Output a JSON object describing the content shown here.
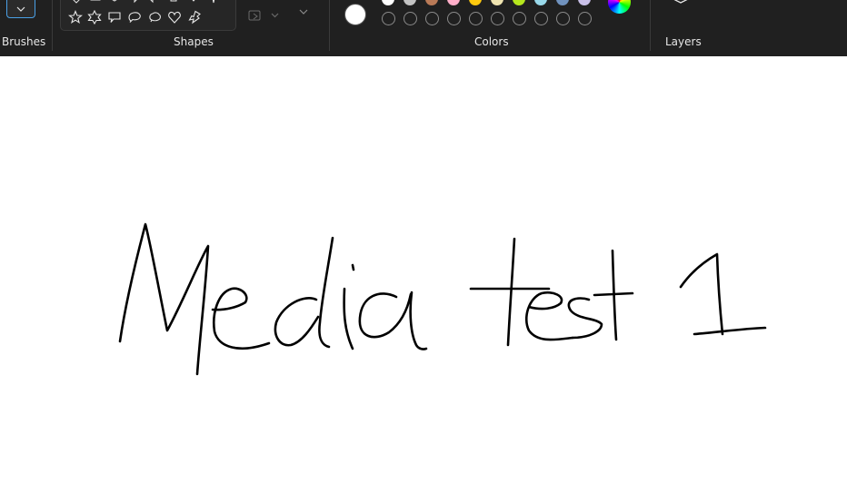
{
  "toolbar": {
    "groups": {
      "brushes": "Brushes",
      "shapes": "Shapes",
      "colors": "Colors",
      "layers": "Layers"
    },
    "primary_color": "#ffffff",
    "palette_row1": [
      "#ffffff",
      "#c3c3c3",
      "#b97a57",
      "#ffaec9",
      "#ffc90e",
      "#efe4b0",
      "#b5e61d",
      "#99d9ea",
      "#7092be",
      "#c8bfe7"
    ],
    "custom_slots": 10
  },
  "canvas": {
    "background": "#ffffff",
    "ink_color": "#000000",
    "handwriting": "Media test 1"
  }
}
